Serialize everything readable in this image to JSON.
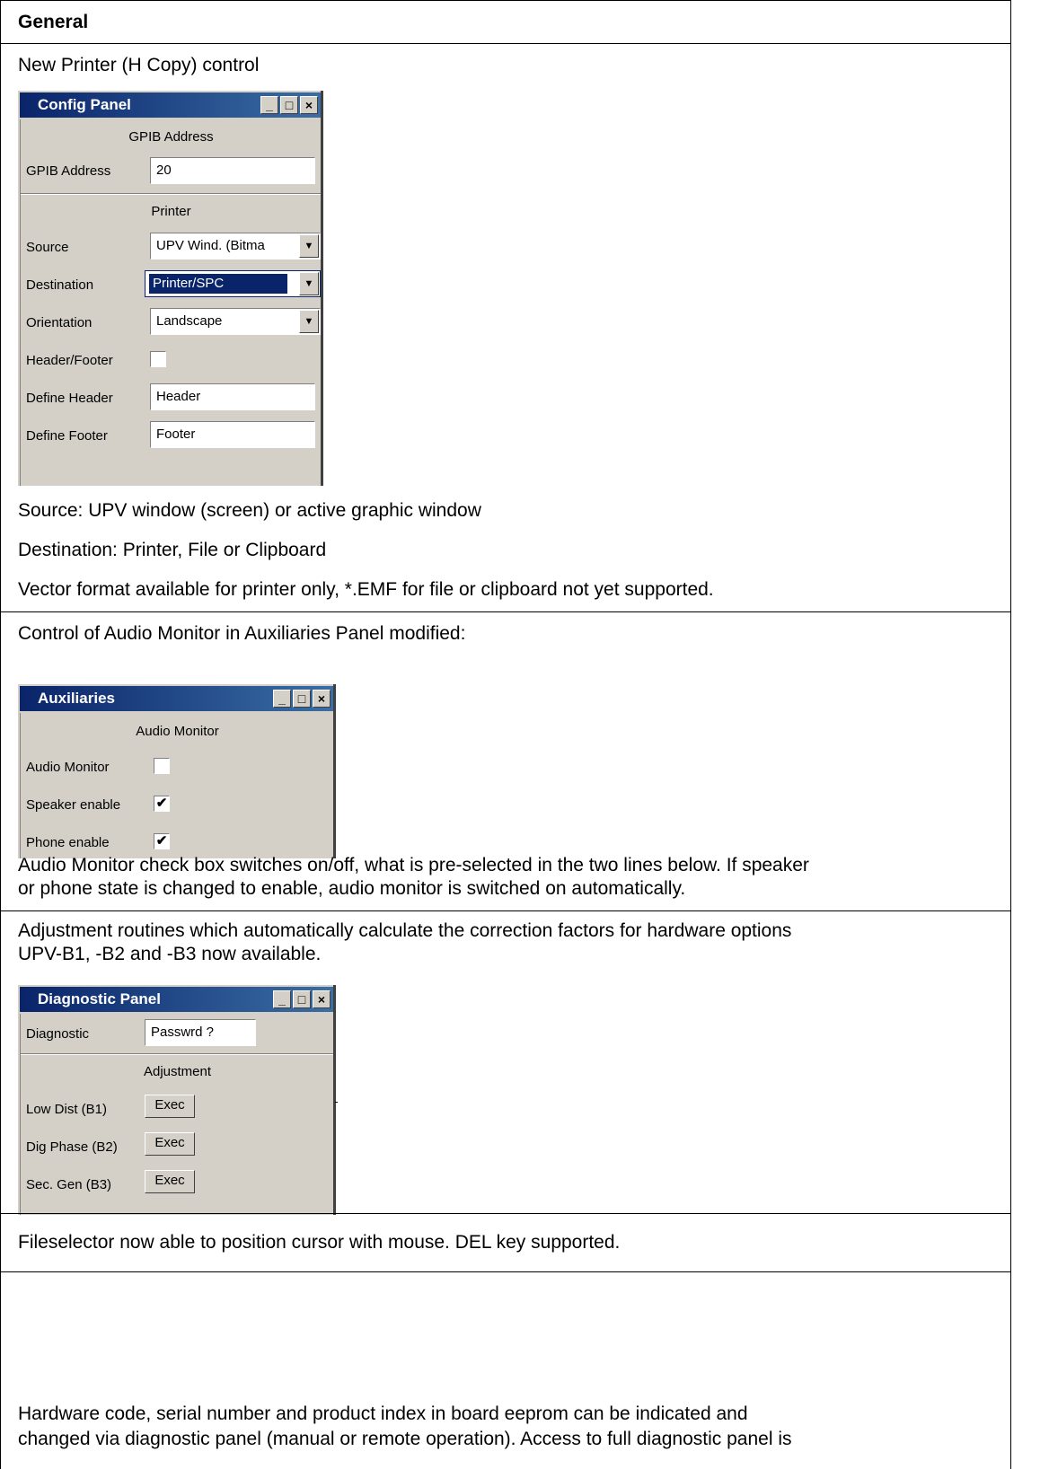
{
  "header": {
    "title": "General"
  },
  "section1": {
    "intro": "New Printer (H Copy) control",
    "panel": {
      "title": "Config Panel",
      "gpib_section": "GPIB Address",
      "gpib_label": "GPIB Address",
      "gpib_value": "20",
      "printer_section": "Printer",
      "source_label": "Source",
      "source_value": "UPV Wind. (Bitma",
      "destination_label": "Destination",
      "destination_value": "Printer/SPC",
      "orientation_label": "Orientation",
      "orientation_value": "Landscape",
      "header_footer_label": "Header/Footer",
      "header_footer_checked": false,
      "define_header_label": "Define Header",
      "define_header_value": "Header",
      "define_footer_label": "Define Footer",
      "define_footer_value": "Footer"
    },
    "note1": "Source: UPV window (screen) or active graphic window",
    "note2": "Destination: Printer, File or Clipboard",
    "note3": "Vector format available for printer only, *.EMF for file or clipboard not yet supported."
  },
  "section2": {
    "intro": "Control of Audio Monitor in Auxiliaries Panel modified:",
    "panel": {
      "title": "Auxiliaries",
      "section": "Audio Monitor",
      "audio_monitor_label": "Audio Monitor",
      "audio_monitor_checked": false,
      "speaker_label": "Speaker enable",
      "speaker_checked": true,
      "phone_label": "Phone enable",
      "phone_checked": true
    },
    "note_line1": "Audio Monitor check box switches on/off, what is pre-selected in the two lines below. If speaker",
    "note_line2": "or phone state is changed to enable, audio monitor is switched on automatically."
  },
  "section3": {
    "intro_line1": "Adjustment routines which automatically calculate the correction factors for hardware options",
    "intro_line2": "UPV-B1, -B2 and -B3  now available.",
    "panel": {
      "title": "Diagnostic Panel",
      "diagnostic_label": "Diagnostic",
      "diagnostic_value": "Passwrd ?",
      "adjustment_section": "Adjustment",
      "low_dist_label": "Low Dist (B1)",
      "dig_phase_label": "Dig Phase (B2)",
      "sec_gen_label": "Sec. Gen (B3)",
      "exec_label": "Exec"
    }
  },
  "section4": {
    "text": "Fileselector now able to position cursor with mouse. DEL key supported."
  },
  "section5": {
    "line1": "Hardware code, serial number and product index in board eeprom can be indicated and",
    "line2": "changed via diagnostic panel (manual or remote operation). Access to full diagnostic panel is"
  },
  "window_controls": {
    "minimize": "_",
    "maximize": "□",
    "close": "×"
  },
  "checkmark": "✔"
}
